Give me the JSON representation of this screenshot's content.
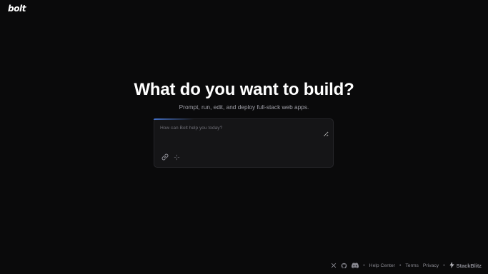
{
  "brand": {
    "logo_text": "bolt"
  },
  "hero": {
    "title": "What do you want to build?",
    "subtitle": "Prompt, run, edit, and deploy full-stack web apps."
  },
  "prompt": {
    "placeholder": "How can Bolt help you today?",
    "value": "",
    "tools": [
      {
        "icon": "link-icon",
        "label": "Attach"
      },
      {
        "icon": "sparkle-icon",
        "label": "Enhance prompt"
      }
    ]
  },
  "footer": {
    "social_icons": [
      "x-icon",
      "github-icon",
      "discord-icon"
    ],
    "separator": "•",
    "links": {
      "help_center": "Help Center",
      "terms": "Terms",
      "privacy": "Privacy"
    },
    "stackblitz_label": "StackBlitz"
  },
  "colors": {
    "background": "#0a0a0b",
    "surface": "#151517",
    "text": "#ffffff",
    "muted": "#a0a0a8",
    "accent": "#508cff"
  }
}
